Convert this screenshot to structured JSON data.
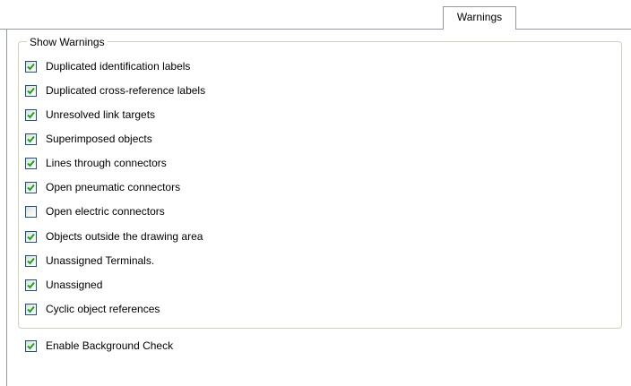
{
  "tab": {
    "label": "Warnings"
  },
  "group": {
    "legend": "Show Warnings",
    "items": [
      {
        "label": "Duplicated identification labels",
        "checked": true
      },
      {
        "label": "Duplicated cross-reference labels",
        "checked": true
      },
      {
        "label": "Unresolved link targets",
        "checked": true
      },
      {
        "label": "Superimposed objects",
        "checked": true
      },
      {
        "label": "Lines through connectors",
        "checked": true
      },
      {
        "label": "Open pneumatic connectors",
        "checked": true
      },
      {
        "label": "Open electric connectors",
        "checked": false
      },
      {
        "label": "Objects outside the drawing area",
        "checked": true
      },
      {
        "label": "Unassigned Terminals.",
        "checked": true
      },
      {
        "label": "Unassigned",
        "checked": true
      },
      {
        "label": "Cyclic object references",
        "checked": true
      }
    ]
  },
  "background_check": {
    "label": "Enable Background Check",
    "checked": true
  },
  "colors": {
    "checkmark": "#21a121",
    "checkbox_border": "#1c5180",
    "group_border": "#d0d0bf",
    "tab_border": "#919b9c"
  }
}
